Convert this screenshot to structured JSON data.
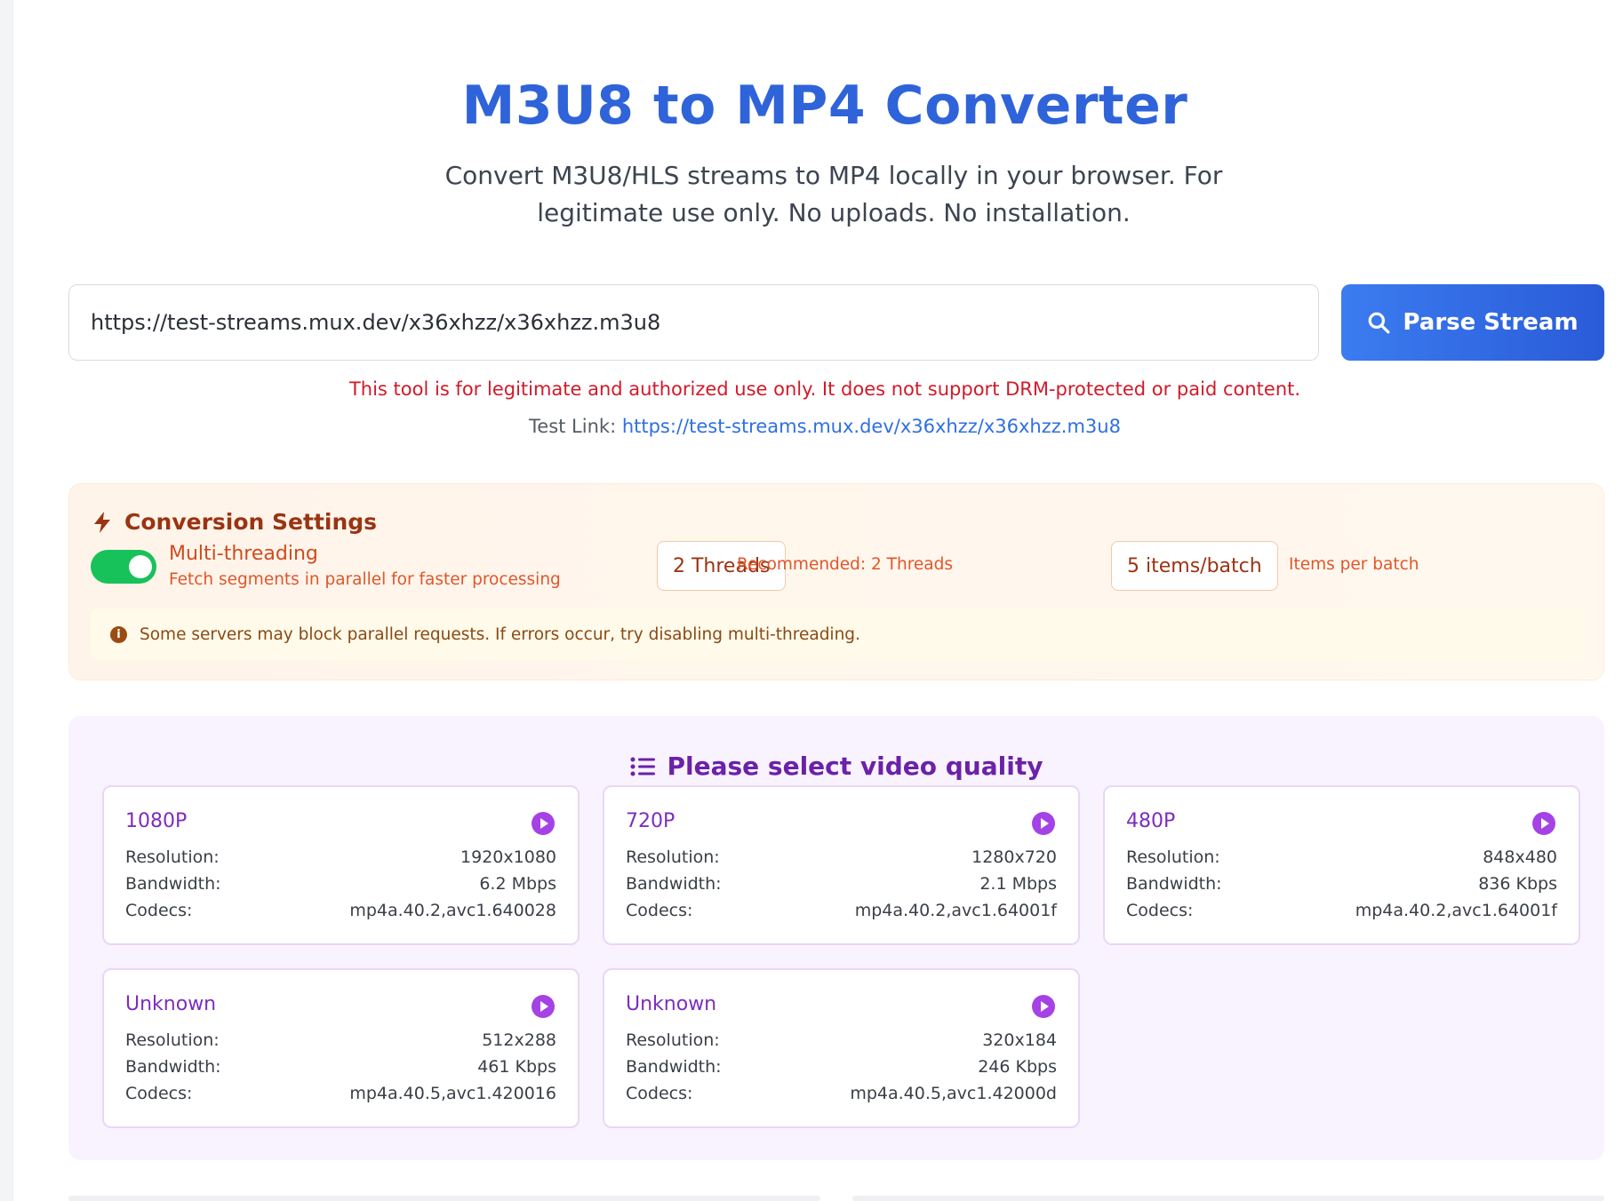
{
  "header": {
    "title": "M3U8 to MP4 Converter",
    "subtitle": "Convert M3U8/HLS streams to MP4 locally in your browser. For legitimate use only. No uploads. No installation."
  },
  "input": {
    "url_value": "https://test-streams.mux.dev/x36xhzz/x36xhzz.m3u8",
    "parse_button_label": "Parse Stream"
  },
  "notice": {
    "warning": "This tool is for legitimate and authorized use only. It does not support DRM-protected or paid content.",
    "test_link_label": "Test Link:",
    "test_link_url": "https://test-streams.mux.dev/x36xhzz/x36xhzz.m3u8"
  },
  "settings": {
    "title": "Conversion Settings",
    "multithreading": {
      "label": "Multi-threading",
      "description": "Fetch segments in parallel for faster processing",
      "enabled": true
    },
    "threads": {
      "value": "2 Threads",
      "hint": "Recommended: 2 Threads"
    },
    "batch": {
      "value": "5 items/batch",
      "hint": "Items per batch"
    },
    "warning": "Some servers may block parallel requests. If errors occur, try disabling multi-threading."
  },
  "quality": {
    "title": "Please select video quality",
    "labels": {
      "resolution": "Resolution:",
      "bandwidth": "Bandwidth:",
      "codecs": "Codecs:"
    },
    "options": [
      {
        "name": "1080P",
        "resolution": "1920x1080",
        "bandwidth": "6.2 Mbps",
        "codecs": "mp4a.40.2,avc1.640028"
      },
      {
        "name": "720P",
        "resolution": "1280x720",
        "bandwidth": "2.1 Mbps",
        "codecs": "mp4a.40.2,avc1.64001f"
      },
      {
        "name": "480P",
        "resolution": "848x480",
        "bandwidth": "836 Kbps",
        "codecs": "mp4a.40.2,avc1.64001f"
      },
      {
        "name": "Unknown",
        "resolution": "512x288",
        "bandwidth": "461 Kbps",
        "codecs": "mp4a.40.5,avc1.420016"
      },
      {
        "name": "Unknown",
        "resolution": "320x184",
        "bandwidth": "246 Kbps",
        "codecs": "mp4a.40.5,avc1.42000d"
      }
    ]
  },
  "colors": {
    "title_blue": "#2f63d9",
    "button_blue": "#2a5bd8",
    "warning_red": "#d11a2a",
    "toggle_green": "#18c25a",
    "settings_orange": "#9a3412",
    "quality_purple": "#6b21a8"
  }
}
